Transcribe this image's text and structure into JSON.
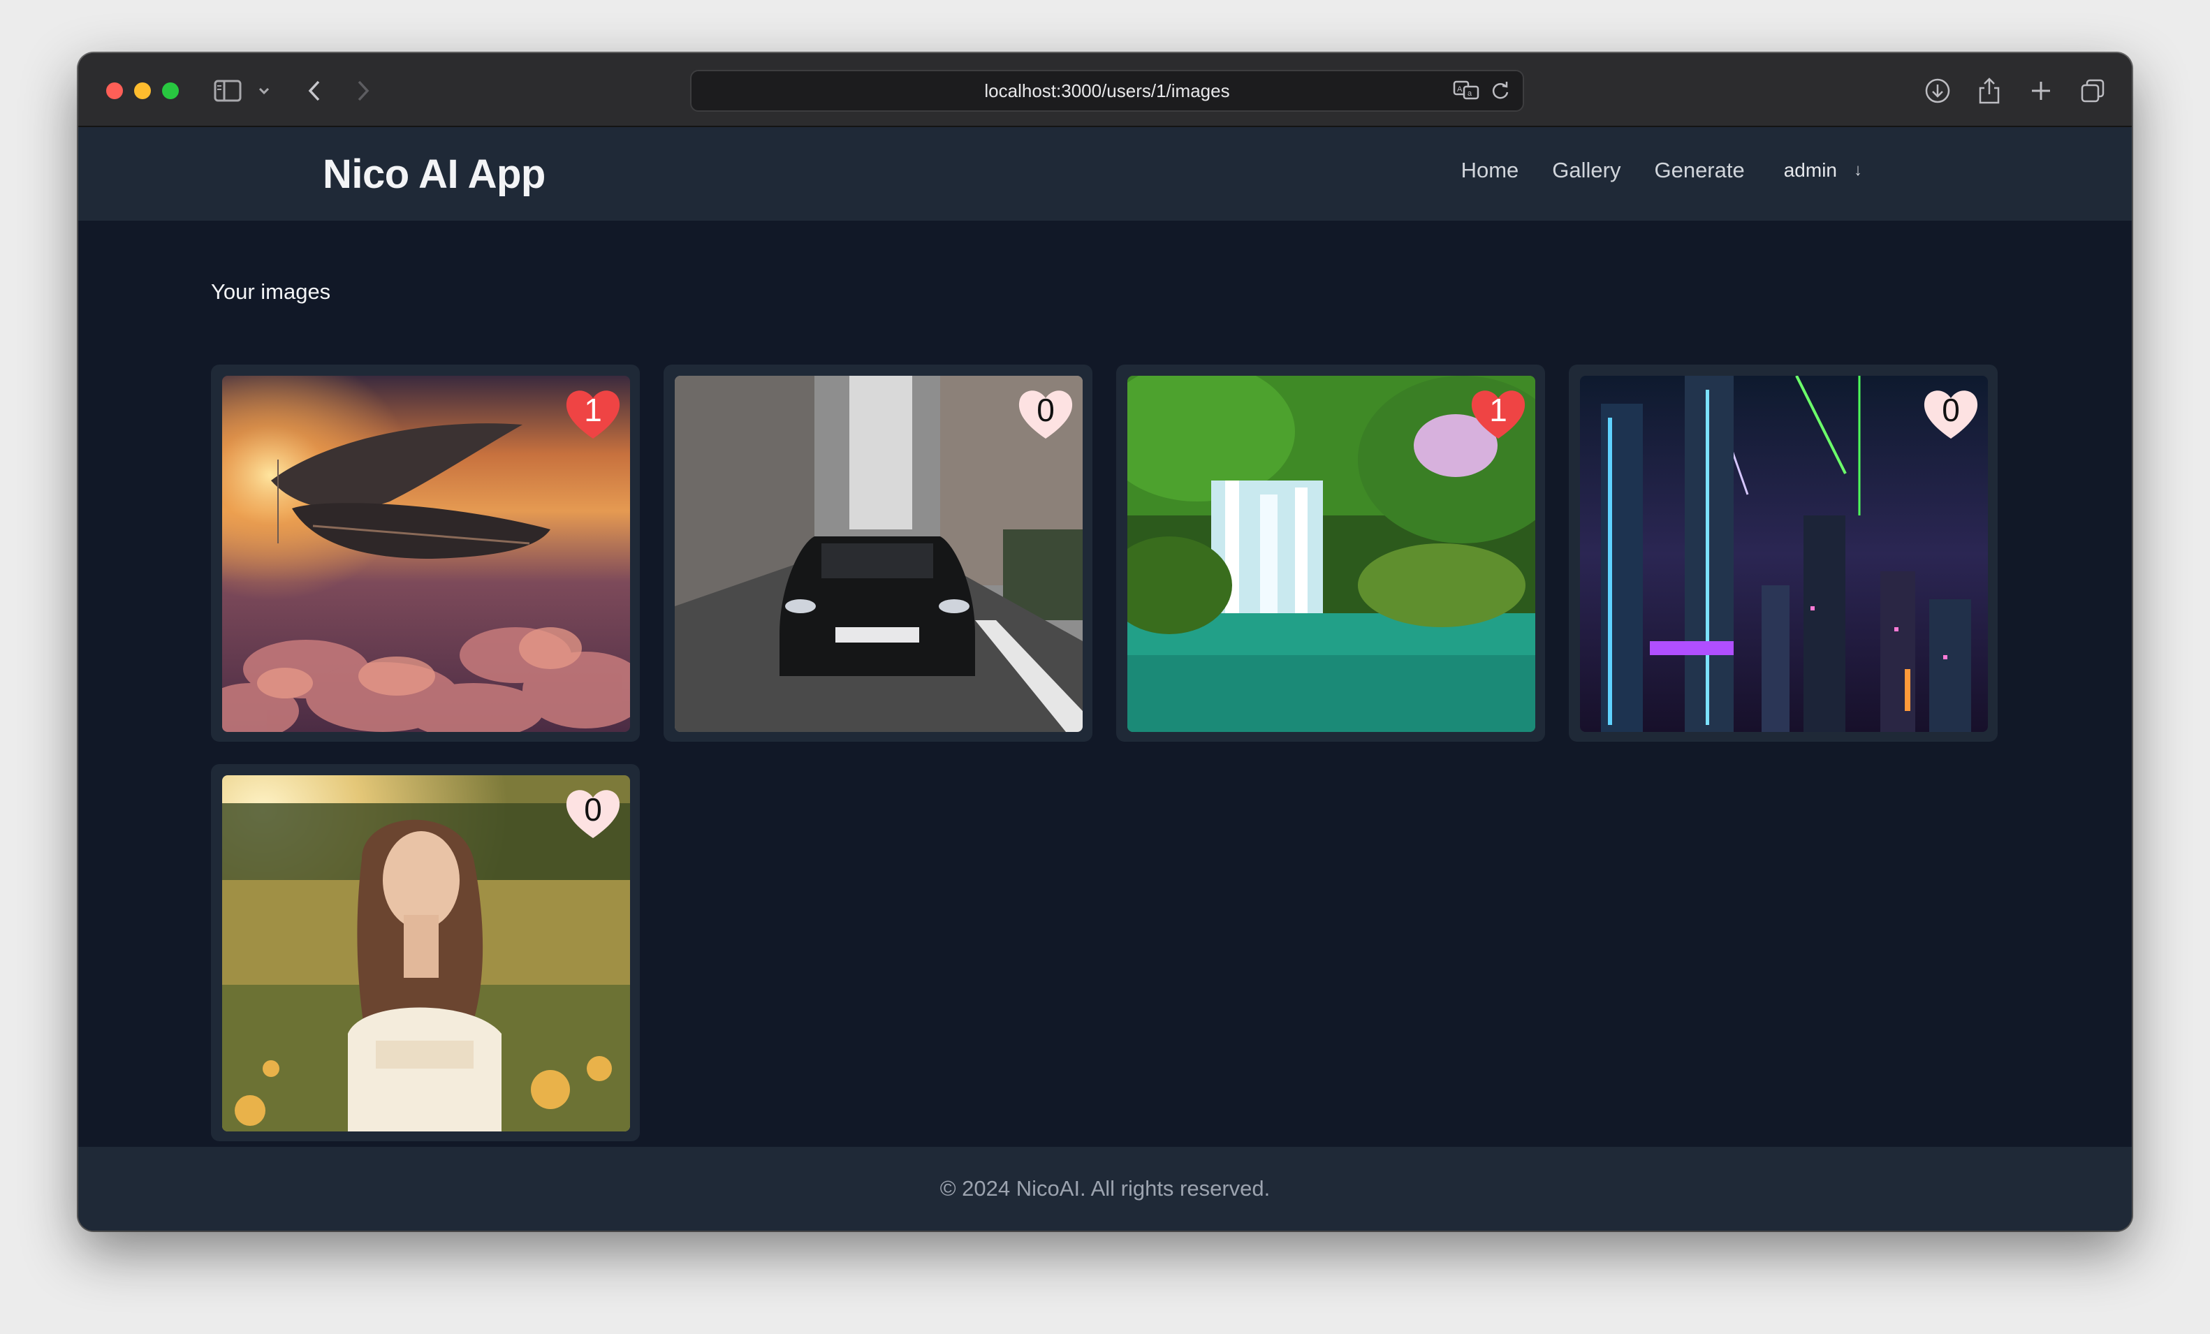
{
  "browser": {
    "url": "localhost:3000/users/1/images",
    "icons": [
      "sidebar-icon",
      "chevron-down-icon",
      "back-icon",
      "forward-icon",
      "translate-icon",
      "reload-icon",
      "download-icon",
      "share-icon",
      "new-tab-icon",
      "tabs-overview-icon"
    ]
  },
  "navbar": {
    "brand": "Nico AI App",
    "links": [
      "Home",
      "Gallery",
      "Generate"
    ],
    "user": "admin",
    "user_arrow": "↓"
  },
  "main": {
    "section_title": "Your images",
    "images": [
      {
        "subject": "steampunk airship above clouds at sunset",
        "likes": "1",
        "liked": true
      },
      {
        "subject": "black car on city street",
        "likes": "0",
        "liked": false
      },
      {
        "subject": "jungle waterfall with lagoon",
        "likes": "1",
        "liked": true
      },
      {
        "subject": "cyberpunk city at night",
        "likes": "0",
        "liked": false
      },
      {
        "subject": "woman in flower field at sunset",
        "likes": "0",
        "liked": false
      }
    ]
  },
  "footer": {
    "text": "© 2024 NicoAI. All rights reserved."
  },
  "colors": {
    "page_bg": "#111827",
    "bar_bg": "#1f2937",
    "liked_heart": "#ef4444",
    "unliked_heart": "#fde2e2"
  }
}
